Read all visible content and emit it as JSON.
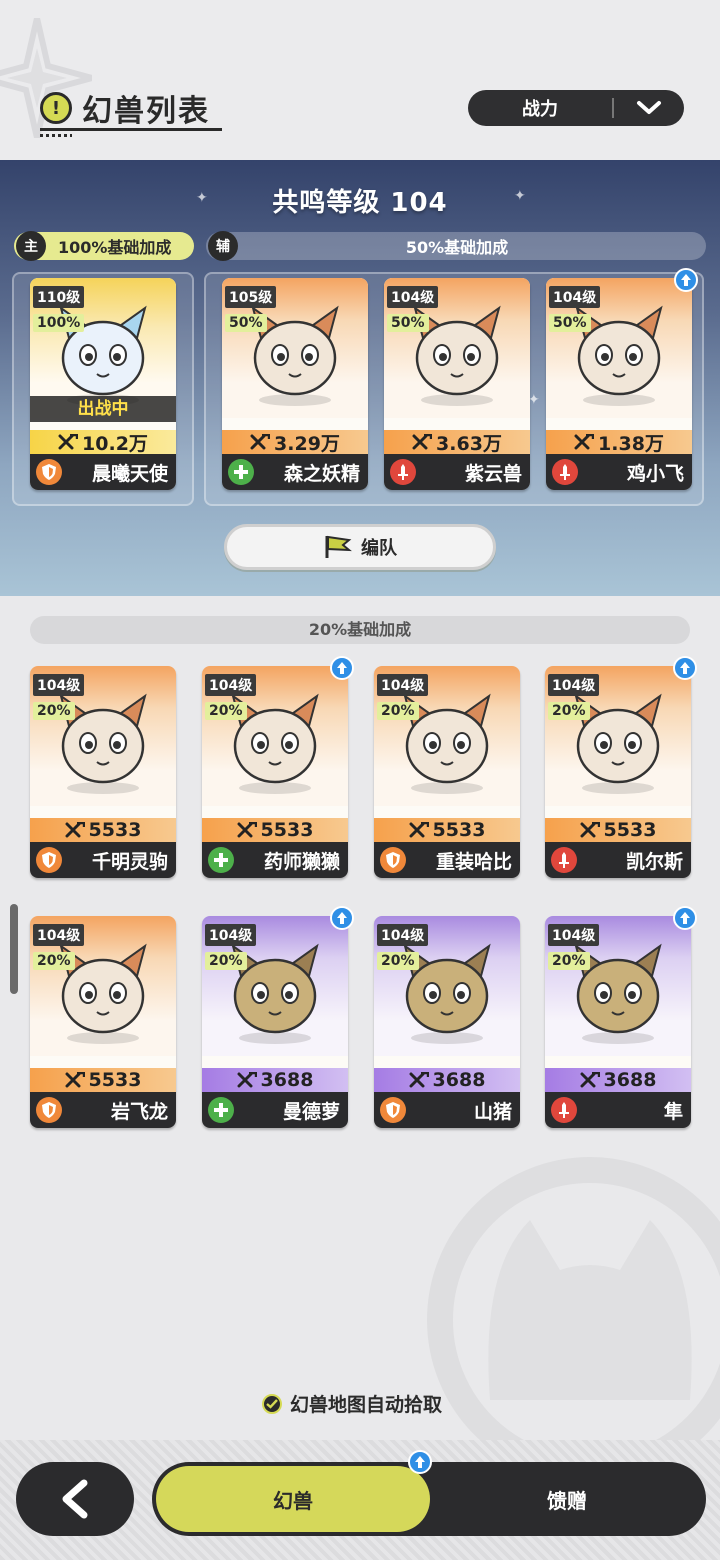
{
  "header": {
    "title": "幻兽列表",
    "title_icon": "!",
    "sort": {
      "label": "战力"
    }
  },
  "resonance": {
    "title": "共鸣等级 104",
    "main": {
      "badge": "主",
      "label": "100%基础加成"
    },
    "sub": {
      "badge": "辅",
      "label": "50%基础加成"
    },
    "formation_label": "编队"
  },
  "deployed_status": "出战中",
  "team": [
    {
      "level": "110级",
      "percent": "100%",
      "power": "10.2万",
      "name": "晨曦天使",
      "role": "defense",
      "theme": "gold",
      "upgrade": false,
      "deployed": true
    },
    {
      "level": "105级",
      "percent": "50%",
      "power": "3.29万",
      "name": "森之妖精",
      "role": "heal",
      "theme": "orange",
      "upgrade": false
    },
    {
      "level": "104级",
      "percent": "50%",
      "power": "3.63万",
      "name": "紫云兽",
      "role": "attack",
      "theme": "orange",
      "upgrade": false
    },
    {
      "level": "104级",
      "percent": "50%",
      "power": "1.38万",
      "name": "鸡小飞",
      "role": "attack",
      "theme": "orange",
      "upgrade": true
    }
  ],
  "reserve": {
    "label": "20%基础加成",
    "cards": [
      {
        "level": "104级",
        "percent": "20%",
        "power": "5533",
        "name": "千明灵驹",
        "role": "defense",
        "theme": "orange",
        "upgrade": false
      },
      {
        "level": "104级",
        "percent": "20%",
        "power": "5533",
        "name": "药师獭獭",
        "role": "heal",
        "theme": "orange",
        "upgrade": true
      },
      {
        "level": "104级",
        "percent": "20%",
        "power": "5533",
        "name": "重装哈比",
        "role": "defense",
        "theme": "orange",
        "upgrade": false
      },
      {
        "level": "104级",
        "percent": "20%",
        "power": "5533",
        "name": "凯尔斯",
        "role": "attack",
        "theme": "orange",
        "upgrade": true
      },
      {
        "level": "104级",
        "percent": "20%",
        "power": "5533",
        "name": "岩飞龙",
        "role": "defense",
        "theme": "orange",
        "upgrade": false
      },
      {
        "level": "104级",
        "percent": "20%",
        "power": "3688",
        "name": "曼德萝",
        "role": "heal",
        "theme": "purple",
        "upgrade": true
      },
      {
        "level": "104级",
        "percent": "20%",
        "power": "3688",
        "name": "山猪",
        "role": "defense",
        "theme": "purple",
        "upgrade": false
      },
      {
        "level": "104级",
        "percent": "20%",
        "power": "3688",
        "name": "隼",
        "role": "attack",
        "theme": "purple",
        "upgrade": true
      }
    ]
  },
  "auto_pick": {
    "label": "幻兽地图自动拾取",
    "checked": true
  },
  "bottom_nav": {
    "tab_active": "幻兽",
    "tab_other": "馈赠"
  },
  "colors": {
    "accent": "#d5d85a",
    "dark": "#2b2b2d",
    "role_defense": "#f0883a",
    "role_heal": "#4db04a",
    "role_attack": "#e0473c",
    "upgrade": "#2f8fe6"
  }
}
